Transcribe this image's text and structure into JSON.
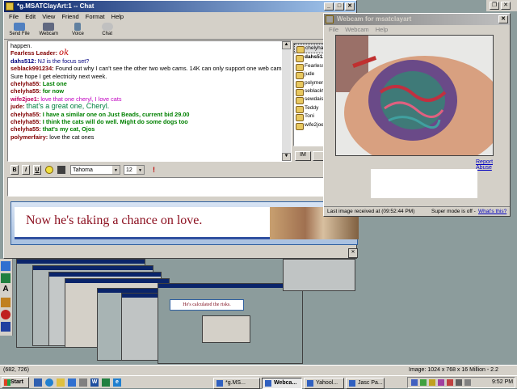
{
  "chat_window": {
    "title": "*g.MSATClayArt:1 -- Chat",
    "menu": [
      "File",
      "Edit",
      "View",
      "Friend",
      "Format",
      "Help"
    ],
    "toolbar": [
      "Send File",
      "Webcam",
      "Voice",
      "Chat"
    ],
    "messages": [
      {
        "user": "",
        "text": "happen.",
        "color": "#000000"
      },
      {
        "user": "Fearless Leader:",
        "text": "ok",
        "color": "#800000",
        "text_color": "#c00000"
      },
      {
        "user": "dahs512:",
        "text": "NJ is the focus set?",
        "color": "#000080",
        "text_color": "#000080"
      },
      {
        "user": "seblack991234:",
        "text": "Found out why I can't see the other two web cams. 14K can only support one web cam. Sure hope I get electricity next week.",
        "color": "#800000",
        "text_color": "#000000"
      },
      {
        "user": "chelyha55:",
        "text": "Last one",
        "color": "#800000",
        "text_color": "#008000"
      },
      {
        "user": "chelyha55:",
        "text": "for now",
        "color": "#800000",
        "text_color": "#008000"
      },
      {
        "user": "wife2joe1:",
        "text": "love that one cheryl, I love cats",
        "color": "#c00060",
        "text_color": "#c000c0"
      },
      {
        "user": "jude:",
        "text": "that's a great one, Cheryl.",
        "color": "#800000",
        "text_color": "#008040"
      },
      {
        "user": "chelyha55:",
        "text": "I have a similar one on Just Beads, current bid 29.00",
        "color": "#800000",
        "text_color": "#008000"
      },
      {
        "user": "chelyha55:",
        "text": "I think the cats will do well. Might do some dogs too",
        "color": "#800000",
        "text_color": "#008000"
      },
      {
        "user": "chelyha55:",
        "text": "that's my cat, Ojos",
        "color": "#800000",
        "text_color": "#008000"
      },
      {
        "user": "polymerfairy:",
        "text": "love the cat ones",
        "color": "#800000",
        "text_color": "#000000"
      }
    ],
    "users": [
      "chelyha55",
      "dahs512",
      "Fearless Le",
      "jude",
      "polymerfairy",
      "seblack9",
      "sewdaisy",
      "Teddy",
      "Toni",
      "wife2joe1"
    ],
    "buttons": {
      "im": "IM",
      "profile": ""
    },
    "format_bar": {
      "bold": "B",
      "italic": "I",
      "underline": "U",
      "font": "Tahoma",
      "size": "12"
    },
    "input_value": ""
  },
  "ad_banner": {
    "text": "Now he's taking a chance on love."
  },
  "webcam_window": {
    "title": "Webcam for msatclayart",
    "menu": [
      "File",
      "Webcam",
      "Help"
    ],
    "report_link": "Report Abuse",
    "last_image": "Last image received at (09:52:44 PM)",
    "super_mode": "Super mode is off -",
    "whats_this": "What's this?"
  },
  "background_app": {
    "coords": "(682, 726)",
    "image_info": "Image: 1024 x 768 x 16 Million - 2.2 MBytes",
    "nested_caption": "He's calculated the risks."
  },
  "taskbar": {
    "start": "Start",
    "tasks": [
      "*g.MS...",
      "Webca...",
      "Yahool...",
      "Jasc Pa..."
    ],
    "clock": "9:52 PM"
  }
}
